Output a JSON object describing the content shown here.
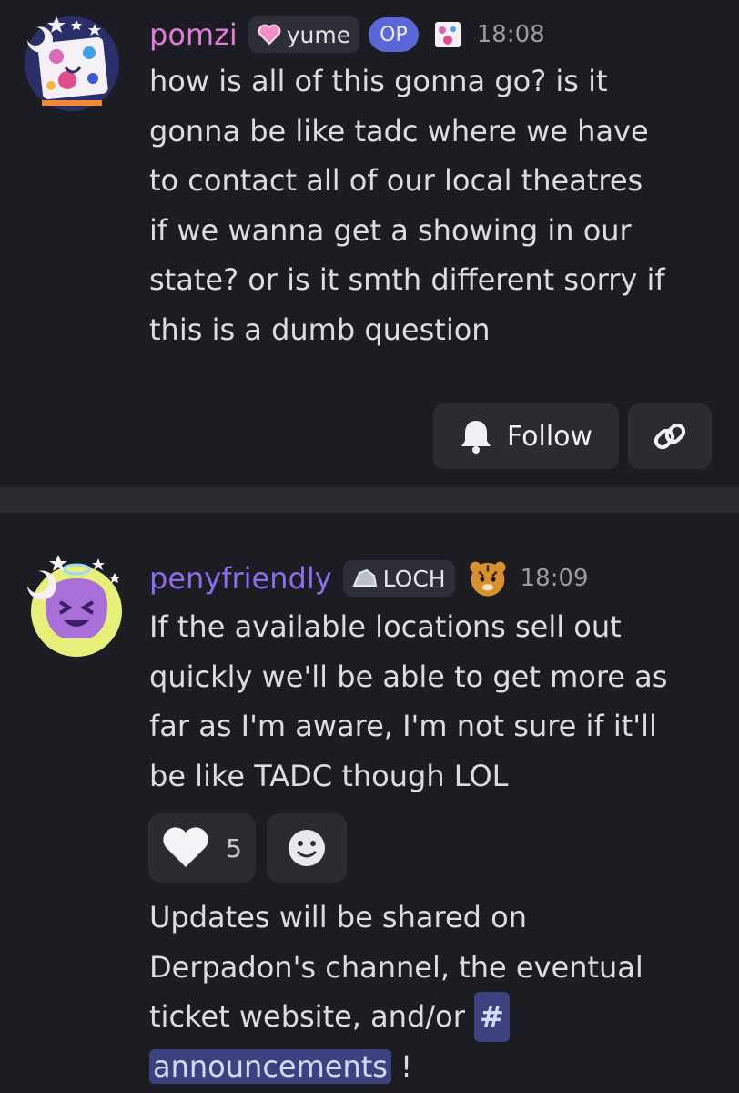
{
  "op_post": {
    "username": "pomzi",
    "username_color": "#e07bd6",
    "role_tag": "yume",
    "role_icon": "pink-heart-icon",
    "op_badge": "OP",
    "timestamp": "18:08",
    "message_lines": [
      "how is all of this gonna go? is it",
      "gonna be like tadc where we have",
      "to contact all of our local theatres",
      "if we wanna get a showing in our",
      "state? or is it smth different sorry if",
      "this is a dumb question"
    ],
    "follow_label": "Follow",
    "follow_icon": "bell-icon",
    "link_icon": "link-icon"
  },
  "reply": {
    "username": "penyfriendly",
    "username_color": "#8e6cf0",
    "role_tag": "LOCH",
    "role_icon": "rock-icon",
    "badge_icon": "tiger-icon",
    "timestamp": "18:09",
    "message_lines": [
      "If the available locations sell out",
      "quickly we'll be able to get more as",
      "far as I'm aware, I'm not sure if it'll",
      "be like TADC though LOL"
    ],
    "reaction_emoji": "🤍",
    "reaction_count": "5",
    "add_reaction_icon": "smile-icon",
    "second_message_lines": [
      "Updates will be shared on",
      "Derpadon's channel, the eventual",
      "ticket website, and/or"
    ],
    "channel_hash": "#",
    "channel_name": "announcements",
    "trailing_punct": "!"
  },
  "colors": {
    "background": "#1c1d22",
    "divider": "#2a2b31",
    "button": "#2b2c32",
    "mention": "#3c4180",
    "op_badge": "#5b66d8"
  }
}
